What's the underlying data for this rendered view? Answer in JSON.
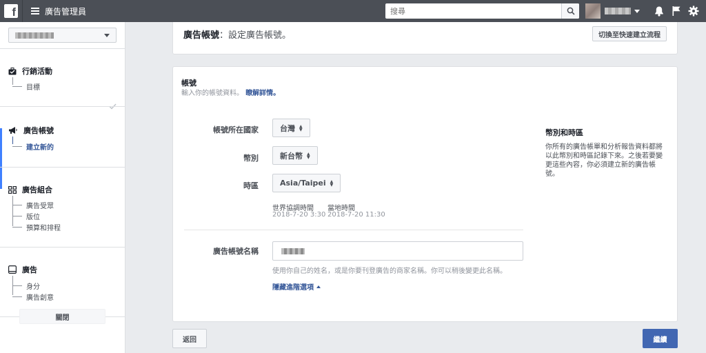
{
  "topbar": {
    "logo": "f",
    "title": "廣告管理員",
    "search_placeholder": "搜尋",
    "icons": [
      "facebook-logo",
      "menu-icon",
      "search-icon",
      "bell-icon",
      "flag-icon",
      "gear-icon"
    ]
  },
  "sidebar": {
    "close_label": "關閉",
    "sections": [
      {
        "title": "行銷活動",
        "icon": "briefcase-icon",
        "items": [
          {
            "label": "目標",
            "state": "done"
          }
        ]
      },
      {
        "title": "廣告帳號",
        "icon": "megaphone-icon",
        "items": [
          {
            "label": "建立新的",
            "state": "active"
          }
        ]
      },
      {
        "title": "廣告組合",
        "icon": "grid-icon",
        "items": [
          {
            "label": "廣告受眾"
          },
          {
            "label": "版位"
          },
          {
            "label": "預算和排程"
          }
        ]
      },
      {
        "title": "廣告",
        "icon": "monitor-icon",
        "items": [
          {
            "label": "身分"
          },
          {
            "label": "廣告創意"
          }
        ]
      }
    ]
  },
  "header_card": {
    "title_bold": "廣告帳號",
    "title_rest": "：設定廣告帳號。",
    "switch_label": "切換至快速建立流程"
  },
  "account_card": {
    "title": "帳號",
    "desc": "輸入你的帳號資料。",
    "learn_more": "瞭解詳情。",
    "country_label": "帳號所在國家",
    "country_value": "台灣",
    "currency_label": "幣別",
    "currency_value": "新台幣",
    "timezone_label": "時區",
    "timezone_value": "Asia/Taipei",
    "utc_caption": "世界協調時間",
    "utc_value": "2018-7-20 3:30",
    "local_caption": "當地時間",
    "local_value": "2018-7-20 11:30",
    "name_label": "廣告帳號名稱",
    "name_hint": "使用你自己的姓名，或是你要刊登廣告的商家名稱。你可以稍後變更此名稱。",
    "advanced_label": "隱藏進階選項",
    "info_title": "幣別和時區",
    "info_body": "你所有的廣告帳單和分析報告資料都將以此幣別和時區記錄下來。之後若要變更這些內容，你必須建立新的廣告帳號。"
  },
  "footer": {
    "back_label": "返回",
    "next_label": "繼續"
  },
  "colors": {
    "topbar": "#4b4f56",
    "accent": "#4080ff",
    "primary_button": "#4267b2",
    "link": "#365899"
  }
}
